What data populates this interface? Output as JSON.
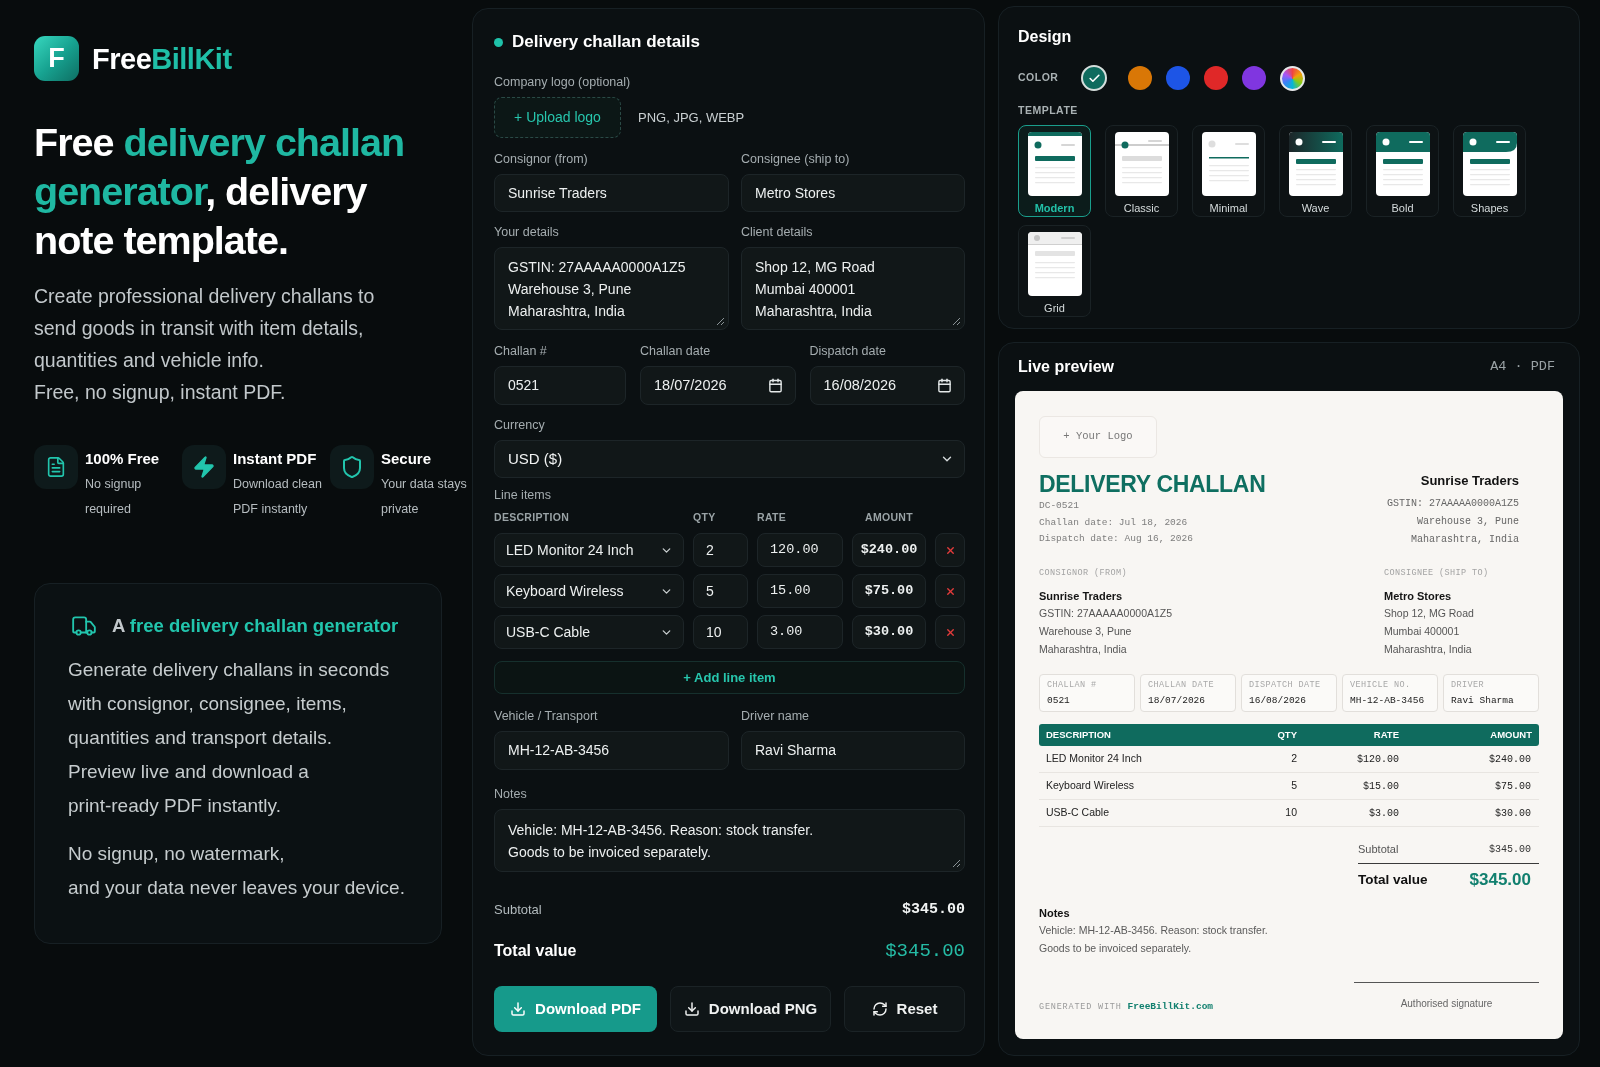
{
  "brand": {
    "mark": "F",
    "name": "Free",
    "name_accent": "BillKit"
  },
  "hero": {
    "headline": [
      {
        "text": "Free ",
        "accent": false
      },
      {
        "text": "delivery challan generator",
        "accent": true
      },
      {
        "text": ", delivery note template.",
        "accent": false
      }
    ],
    "description": [
      "Create professional delivery challans to send goods in transit with item details, quantities and vehicle info.",
      "Free, no signup, instant PDF."
    ],
    "features": [
      {
        "kind": "document",
        "title": "100% Free",
        "text": "No signup required"
      },
      {
        "kind": "bolt",
        "title": "Instant PDF",
        "text": "Download clean PDF instantly"
      },
      {
        "kind": "shield",
        "title": "Secure",
        "text": "Your data stays private"
      }
    ]
  },
  "info_card": {
    "title": [
      {
        "text": "A ",
        "accent": false
      },
      {
        "text": "free delivery challan generator",
        "accent": true
      }
    ],
    "paragraphs": [
      [
        "Generate delivery challans in seconds with consignor, consignee, items, quantities and transport details.",
        "Preview live and download a print-ready PDF instantly."
      ],
      [
        "No signup, no watermark,",
        "and your data never leaves your device."
      ]
    ]
  },
  "form": {
    "title": "Delivery challan details",
    "logo": {
      "label": "Company logo (optional)",
      "button": "+ Upload logo",
      "hint": "PNG, JPG, WEBP"
    },
    "consignor": {
      "label": "Consignor (from)",
      "value": "Sunrise Traders"
    },
    "consignee": {
      "label": "Consignee (ship to)",
      "value": "Metro Stores"
    },
    "your_details": {
      "label": "Your details",
      "value": [
        "GSTIN: 27AAAAA0000A1Z5",
        "Warehouse 3, Pune",
        "Maharashtra, India"
      ]
    },
    "client_details": {
      "label": "Client details",
      "value": [
        "Shop 12, MG Road",
        "Mumbai 400001",
        "Maharashtra, India"
      ]
    },
    "challan_number": {
      "label": "Challan #",
      "value": "0521"
    },
    "challan_date": {
      "label": "Challan date",
      "value": "18/07/2026"
    },
    "dispatch_date": {
      "label": "Dispatch date",
      "value": "16/08/2026"
    },
    "currency": {
      "label": "Currency",
      "value": "USD ($)"
    },
    "line_items": {
      "label": "Line items",
      "columns": [
        "DESCRIPTION",
        "QTY",
        "RATE",
        "AMOUNT"
      ],
      "rows": [
        {
          "description": "LED Monitor 24 Inch",
          "qty": "2",
          "rate": "120.00",
          "amount": "$240.00"
        },
        {
          "description": "Keyboard Wireless",
          "qty": "5",
          "rate": "15.00",
          "amount": "$75.00"
        },
        {
          "description": "USB-C Cable",
          "qty": "10",
          "rate": "3.00",
          "amount": "$30.00"
        }
      ],
      "add_button": "+ Add line item"
    },
    "vehicle": {
      "label": "Vehicle / Transport",
      "value": "MH-12-AB-3456"
    },
    "driver": {
      "label": "Driver name",
      "value": "Ravi Sharma"
    },
    "notes": {
      "label": "Notes",
      "value": [
        "Vehicle: MH-12-AB-3456. Reason: stock transfer.",
        "Goods to be invoiced separately."
      ]
    },
    "subtotal": {
      "label": "Subtotal",
      "value": "$345.00"
    },
    "total": {
      "label": "Total value",
      "value": "$345.00"
    },
    "actions": [
      {
        "kind": "download",
        "label": "Download PDF",
        "primary": true
      },
      {
        "kind": "download",
        "label": "Download PNG",
        "primary": false
      },
      {
        "kind": "reset",
        "label": "Reset",
        "primary": false
      }
    ]
  },
  "design": {
    "title": "Design",
    "color_label": "COLOR",
    "colors": [
      {
        "kind": "solid",
        "color": "#0f6b5e",
        "selected": true
      },
      {
        "kind": "solid",
        "color": "#d97706",
        "selected": false
      },
      {
        "kind": "solid",
        "color": "#1d55e6",
        "selected": false
      },
      {
        "kind": "solid",
        "color": "#e02828",
        "selected": false
      },
      {
        "kind": "solid",
        "color": "#8036e0",
        "selected": false
      },
      {
        "kind": "custom",
        "selected": false
      }
    ],
    "template_label": "TEMPLATE",
    "templates": [
      {
        "kind": "modern",
        "name": "Modern",
        "selected": true
      },
      {
        "kind": "classic",
        "name": "Classic",
        "selected": false
      },
      {
        "kind": "minimal",
        "name": "Minimal",
        "selected": false
      },
      {
        "kind": "wave",
        "name": "Wave",
        "selected": false
      },
      {
        "kind": "bold",
        "name": "Bold",
        "selected": false
      },
      {
        "kind": "shapes",
        "name": "Shapes",
        "selected": false
      },
      {
        "kind": "grid",
        "name": "Grid",
        "selected": false
      }
    ]
  },
  "preview": {
    "title": "Live preview",
    "format": "A4 · PDF",
    "document": {
      "logo_placeholder": "+ Your Logo",
      "title": "DELIVERY CHALLAN",
      "number": "DC-0521",
      "dates": [
        "Challan date: Jul 18, 2026",
        "Dispatch date: Aug 16, 2026"
      ],
      "sender": {
        "name": "Sunrise Traders",
        "lines": [
          "GSTIN: 27AAAAA0000A1Z5",
          "Warehouse 3, Pune",
          "Maharashtra, India"
        ]
      },
      "parties": [
        {
          "label": "CONSIGNOR (FROM)",
          "name": "Sunrise Traders",
          "lines": [
            "GSTIN: 27AAAAA0000A1Z5",
            "Warehouse 3, Pune",
            "Maharashtra, India"
          ]
        },
        {
          "label": "CONSIGNEE (SHIP TO)",
          "name": "Metro Stores",
          "lines": [
            "Shop 12, MG Road",
            "Mumbai 400001",
            "Maharashtra, India"
          ]
        }
      ],
      "facts": [
        {
          "label": "CHALLAN #",
          "value": "0521"
        },
        {
          "label": "CHALLAN DATE",
          "value": "18/07/2026"
        },
        {
          "label": "DISPATCH DATE",
          "value": "16/08/2026"
        },
        {
          "label": "VEHICLE NO.",
          "value": "MH-12-AB-3456"
        },
        {
          "label": "DRIVER",
          "value": "Ravi Sharma"
        }
      ],
      "table": {
        "columns": [
          "DESCRIPTION",
          "QTY",
          "RATE",
          "AMOUNT"
        ],
        "rows": [
          {
            "description": "LED Monitor 24 Inch",
            "qty": "2",
            "rate": "$120.00",
            "amount": "$240.00"
          },
          {
            "description": "Keyboard Wireless",
            "qty": "5",
            "rate": "$15.00",
            "amount": "$75.00"
          },
          {
            "description": "USB-C Cable",
            "qty": "10",
            "rate": "$3.00",
            "amount": "$30.00"
          }
        ]
      },
      "subtotal": {
        "label": "Subtotal",
        "value": "$345.00"
      },
      "total": {
        "label": "Total value",
        "value": "$345.00"
      },
      "notes": {
        "title": "Notes",
        "lines": [
          "Vehicle: MH-12-AB-3456. Reason: stock transfer.",
          "Goods to be invoiced separately."
        ]
      },
      "footer": {
        "prefix": "GENERATED WITH",
        "link": "FreeBillKit.com"
      },
      "signature": "Authorised signature"
    }
  }
}
